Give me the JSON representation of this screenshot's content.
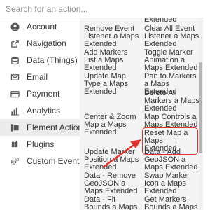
{
  "search": {
    "placeholder": "Search for an action...",
    "value": ""
  },
  "sidebar": {
    "items": [
      {
        "label": "Account",
        "icon": "user-icon"
      },
      {
        "label": "Navigation",
        "icon": "external-link-icon"
      },
      {
        "label": "Data (Things)",
        "icon": "database-icon"
      },
      {
        "label": "Email",
        "icon": "envelope-icon"
      },
      {
        "label": "Payment",
        "icon": "credit-card-icon"
      },
      {
        "label": "Analytics",
        "icon": "bar-chart-icon"
      },
      {
        "label": "Element Actions",
        "icon": "element-actions-icon",
        "active": true
      },
      {
        "label": "Plugins",
        "icon": "plugin-icon"
      },
      {
        "label": "Custom Events",
        "icon": "gears-icon"
      }
    ]
  },
  "actions": {
    "top_right_partial": "Extended",
    "remove_event_listener": "Remove Event Listener a Maps Extended",
    "clear_all_events": "Clear All Event Listener a Maps Extended",
    "add_markers_list": "Add Markers List a Maps Extended",
    "toggle_marker_animation": "Toggle Marker Animation a Maps Extended",
    "update_map_type": "Update Map Type a Maps Extended",
    "pan_to_markers": "Pan to Markers a Maps Extended",
    "delete_all_markers": "Delete All Markers a Maps Extended",
    "center_zoom": "Center & Zoom Map a Maps Extended",
    "map_controls": "Map Controls a Maps Extended",
    "reset_map": "Reset Map a Maps Extended",
    "update_marker_position": "Update Marker Position a Maps Extended",
    "data_add_geojson": "Data - Add GeoJSON a Maps Extended",
    "data_remove_geojson": "Data - Remove GeoJSON a Maps Extended",
    "swap_marker_icon": "Swap Marker Icon a Maps Extended",
    "data_fit_bounds": "Data - Fit Bounds a Maps Extended",
    "get_markers_bounds": "Get Markers Bounds a Maps Extended"
  },
  "colors": {
    "highlight": "#e0322c",
    "arrow": "#e0322c",
    "panel_bg": "#f4f4f4"
  }
}
